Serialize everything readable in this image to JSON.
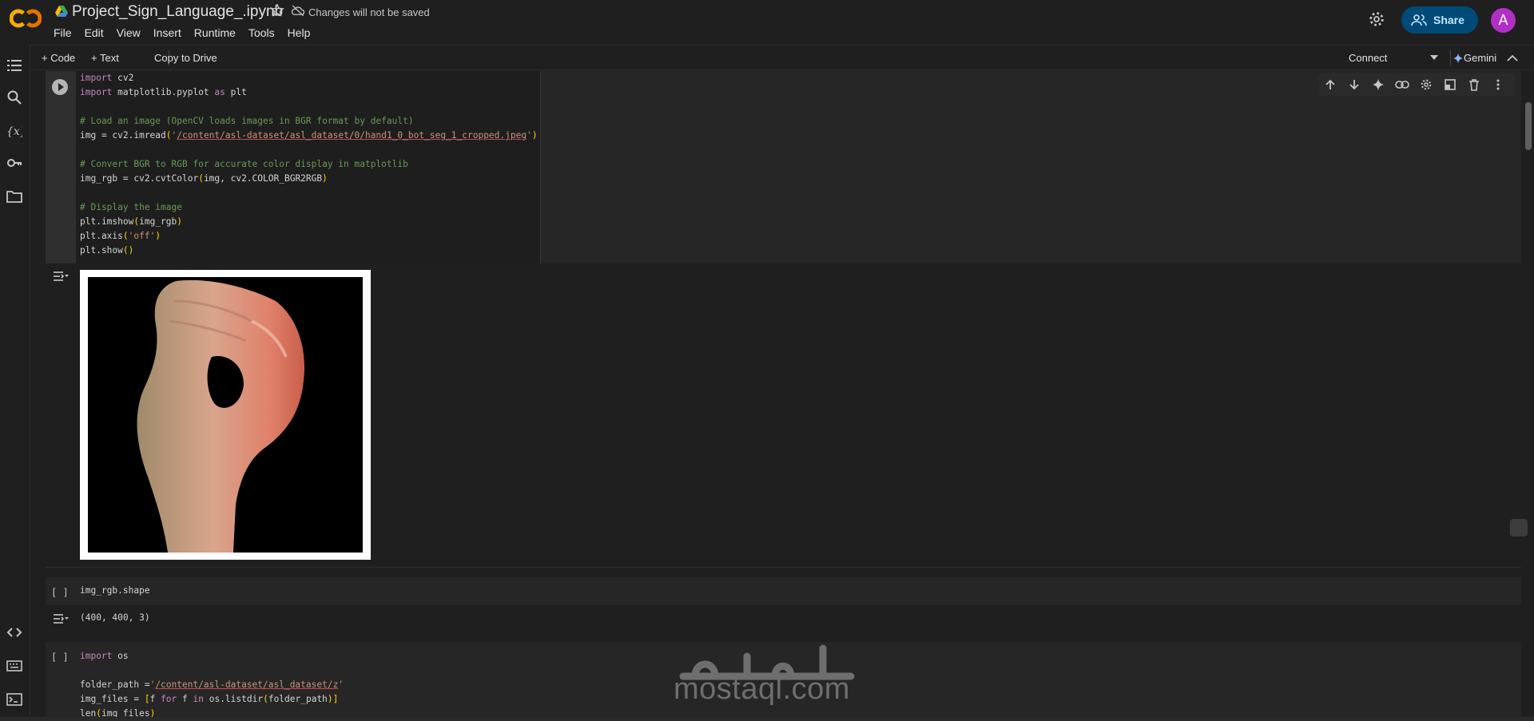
{
  "header": {
    "title": "Project_Sign_Language_.ipynb",
    "save_status": "Changes will not be saved",
    "share_label": "Share",
    "avatar_letter": "A",
    "logo_colors": [
      "#f9ab00",
      "#e37400"
    ]
  },
  "menu": [
    "File",
    "Edit",
    "View",
    "Insert",
    "Runtime",
    "Tools",
    "Help"
  ],
  "toolbar": {
    "add_code": "+ Code",
    "add_text": "+ Text",
    "copy_to_drive": "Copy to Drive",
    "connect": "Connect",
    "gemini": "Gemini"
  },
  "sidebar_icons": [
    "table-of-contents-icon",
    "search-icon",
    "variables-icon",
    "secrets-key-icon",
    "files-folder-icon",
    "code-snippets-icon",
    "command-palette-icon",
    "terminal-icon"
  ],
  "cell_toolbar_icons": [
    "move-up-icon",
    "move-down-icon",
    "gemini-sparkle-icon",
    "link-icon",
    "cell-settings-icon",
    "mirror-cell-icon",
    "delete-icon",
    "more-vert-icon"
  ],
  "cells": [
    {
      "bracket": "",
      "code_lines": [
        "import cv2",
        "import matplotlib.pyplot as plt",
        "",
        "# Load an image (OpenCV loads images in BGR format by default)",
        "img = cv2.imread('/content/asl-dataset/asl_dataset/0/hand1_0_bot_seg_1_cropped.jpeg')",
        "",
        "# Convert BGR to RGB for accurate color display in matplotlib",
        "img_rgb = cv2.cvtColor(img, cv2.COLOR_BGR2RGB)",
        "",
        "# Display the image",
        "plt.imshow(img_rgb)",
        "plt.axis('off')",
        "plt.show()"
      ]
    },
    {
      "bracket": "[ ]",
      "code_lines": [
        "img_rgb.shape"
      ],
      "output": "(400, 400, 3)"
    },
    {
      "bracket": "[ ]",
      "code_lines": [
        "import os",
        "",
        "folder_path ='/content/asl-dataset/asl_dataset/z'",
        "img_files = [f for f in os.listdir(folder_path)]",
        "len(img_files)"
      ]
    }
  ],
  "watermark": "mostaql.com",
  "colors": {
    "background": "#1f1f1f",
    "cell_bg": "#262626",
    "share_bg": "#004a77",
    "avatar_bg": "#b12fc4",
    "keyword": "#c586c0",
    "comment": "#6a9955",
    "string": "#ce9178",
    "paren": "#ffd700"
  }
}
